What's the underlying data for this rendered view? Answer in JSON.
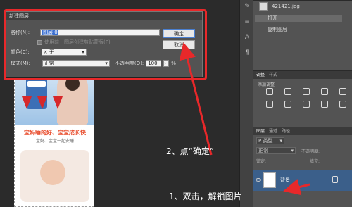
{
  "dialog": {
    "title": "新建图层",
    "name_label": "名称(N):",
    "name_value": "图层 0",
    "clip_option": "使用前一图层创建剪贴蒙版(P)",
    "color_label": "颜色(C):",
    "color_value": "无",
    "color_swatch": "×",
    "mode_label": "模式(M):",
    "mode_value": "正常",
    "opacity_label": "不透明度(O):",
    "opacity_value": "100",
    "opacity_unit": "%",
    "ok_label": "确定",
    "cancel_label": "取消"
  },
  "history": {
    "file_name": "421421.jpg",
    "items": [
      "打开",
      "复制图层"
    ]
  },
  "adjustments": {
    "tabs": [
      "调整",
      "样式"
    ],
    "add_label": "添加调整"
  },
  "layers": {
    "tabs": [
      "图层",
      "通道",
      "路径"
    ],
    "kind_label": "P 类型",
    "mode": "正常",
    "opacity_label": "不透明度:",
    "lock_label": "锁定:",
    "fill_label": "填充:",
    "layer_name": "背景"
  },
  "annotations": {
    "step1": "1、双击，解锁图片",
    "step2": "2、点“确定”"
  },
  "document": {
    "headline": "宝妈睡的好、宝宝成长快",
    "subline": "宝妈、宝宝一起安睡"
  },
  "colors": {
    "highlight": "#e8282a",
    "panel": "#535353",
    "selection": "#3b5f8a"
  }
}
